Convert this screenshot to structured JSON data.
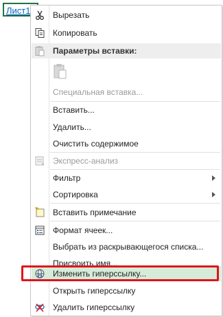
{
  "sheet_tab": {
    "label": "Лист1"
  },
  "menu": {
    "cut": "Вырезать",
    "copy": "Копировать",
    "paste_options_header": "Параметры вставки:",
    "paste_special": "Специальная вставка...",
    "insert": "Вставить...",
    "delete": "Удалить...",
    "clear_contents": "Очистить содержимое",
    "quick_analysis": "Экспресс-анализ",
    "filter": "Фильтр",
    "sort": "Сортировка",
    "insert_comment": "Вставить примечание",
    "format_cells": "Формат ячеек...",
    "pick_from_list": "Выбрать из раскрывающегося списка...",
    "define_name": "Присвоить имя...",
    "edit_hyperlink": "Изменить гиперссылку...",
    "open_hyperlink": "Открыть гиперссылку",
    "remove_hyperlink": "Удалить гиперссылку"
  },
  "colors": {
    "highlight": "#d5ecd9",
    "callout_border": "#e0141c",
    "link": "#0563c1",
    "cell_border": "#217346"
  }
}
